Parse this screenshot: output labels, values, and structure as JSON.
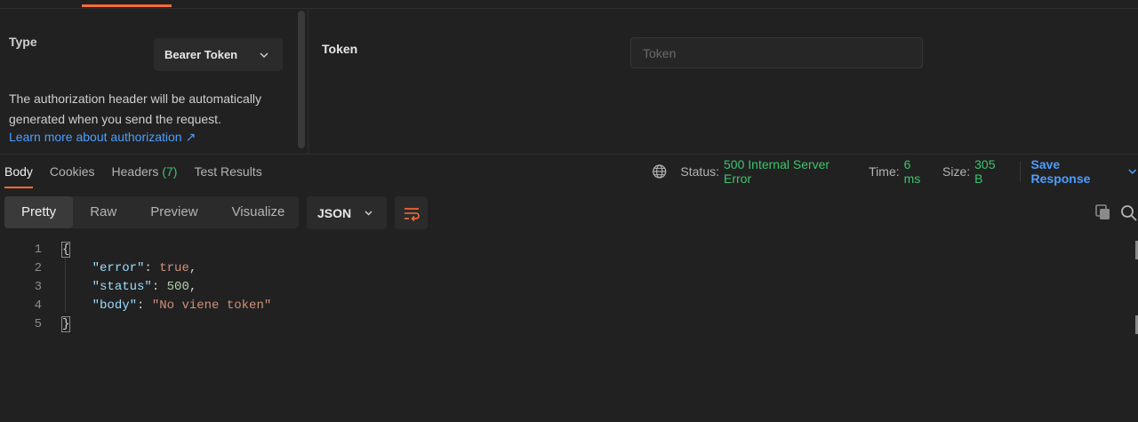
{
  "auth": {
    "type_label": "Type",
    "type_value": "Bearer Token",
    "help_text": "The authorization header will be automatically generated when you send the request.",
    "link_text": "Learn more about authorization ↗",
    "token_label": "Token",
    "token_value": "",
    "token_placeholder": "Token"
  },
  "response": {
    "tabs": [
      {
        "label": "Body"
      },
      {
        "label": "Cookies"
      },
      {
        "label": "Headers",
        "count": "(7)"
      },
      {
        "label": "Test Results"
      }
    ],
    "status_label": "Status:",
    "status_value": "500 Internal Server Error",
    "time_label": "Time:",
    "time_value": "6 ms",
    "size_label": "Size:",
    "size_value": "305 B",
    "save_label": "Save Response"
  },
  "viewer": {
    "modes": [
      "Pretty",
      "Raw",
      "Preview",
      "Visualize"
    ],
    "format": "JSON"
  },
  "body_json": {
    "line_numbers": [
      "1",
      "2",
      "3",
      "4",
      "5"
    ],
    "open_brace": "{",
    "close_brace": "}",
    "key_error": "\"error\"",
    "val_error": "true",
    "key_status": "\"status\"",
    "val_status": "500",
    "key_body": "\"body\"",
    "val_body": "\"No viene token\"",
    "colon": ": ",
    "comma": ","
  },
  "colors": {
    "accent": "#ff6c37",
    "link": "#4d9eff",
    "success": "#3ec46d",
    "json_key": "#9cdcfe",
    "json_string": "#ce9178",
    "json_number": "#b5cea8"
  },
  "icons": [
    "chevron-down-icon",
    "globe-icon",
    "wrap-lines-icon",
    "copy-icon",
    "search-icon"
  ]
}
